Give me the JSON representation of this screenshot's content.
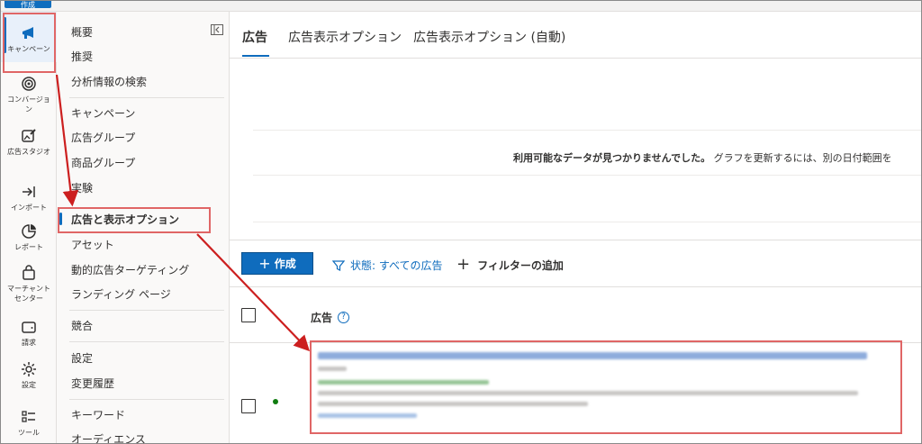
{
  "topbar": {
    "create_mini_label": "作成"
  },
  "rail": {
    "items": [
      {
        "label": "キャンペーン",
        "icon": "megaphone-icon",
        "active": true
      },
      {
        "label": "コンバージョン",
        "icon": "target-icon"
      },
      {
        "label": "広告スタジオ",
        "icon": "image-edit-icon"
      },
      {
        "label": "インポート",
        "icon": "import-icon"
      },
      {
        "label": "レポート",
        "icon": "chart-pie-icon"
      },
      {
        "label": "マーチャント センター",
        "icon": "shopping-bag-icon"
      },
      {
        "label": "請求",
        "icon": "wallet-icon"
      },
      {
        "label": "設定",
        "icon": "gear-icon"
      },
      {
        "label": "ツール",
        "icon": "tools-list-icon"
      }
    ]
  },
  "nav": {
    "items": [
      "概要",
      "推奨",
      "分析情報の検索",
      "キャンペーン",
      "広告グループ",
      "商品グループ",
      "実験",
      "広告と表示オプション",
      "アセット",
      "動的広告ターゲティング",
      "ランディング ページ",
      "競合",
      "設定",
      "変更履歴",
      "キーワード",
      "オーディエンス"
    ],
    "active_index": 7
  },
  "tabs": [
    {
      "label": "広告",
      "active": true
    },
    {
      "label": "広告表示オプション"
    },
    {
      "label": "広告表示オプション (自動)"
    }
  ],
  "chart": {
    "nodata_bold": "利用可能なデータが見つかりませんでした。",
    "nodata_rest": " グラフを更新するには、別の日付範囲を"
  },
  "toolbar": {
    "create_label": "作成",
    "state_filter_label": "状態: すべての広告",
    "add_filter_label": "フィルターの追加"
  },
  "table": {
    "column_ad": "広告",
    "help_glyph": "?"
  },
  "colors": {
    "accent": "#0f6cbd",
    "annotation": "#e06666",
    "status_active": "#107c10"
  }
}
